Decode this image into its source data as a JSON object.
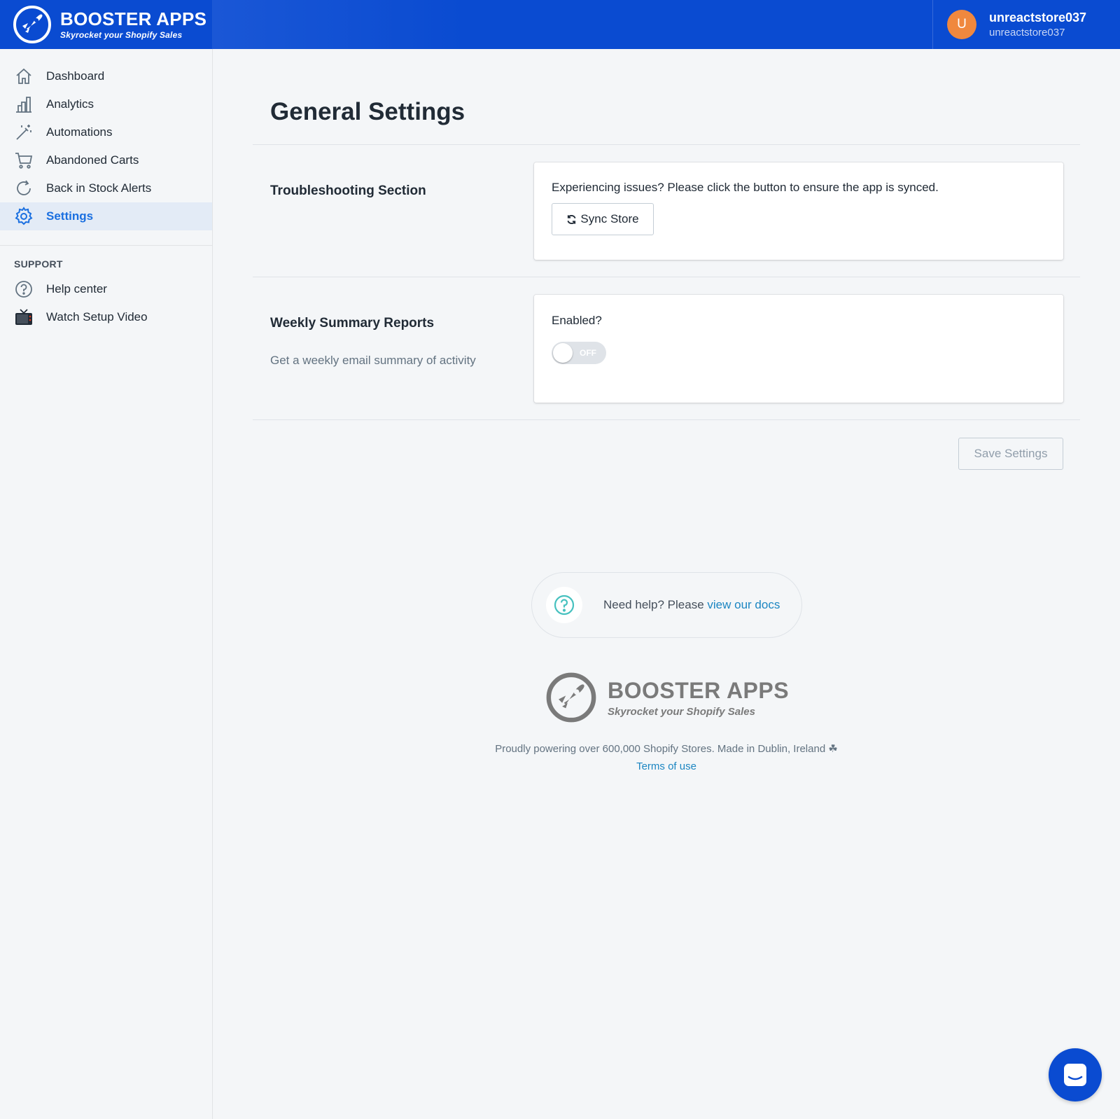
{
  "header": {
    "brand_name": "BOOSTER APPS",
    "brand_tagline": "Skyrocket your Shopify Sales",
    "avatar_initial": "U",
    "user_name": "unreactstore037",
    "user_sub": "unreactstore037"
  },
  "sidebar": {
    "items": [
      {
        "label": "Dashboard",
        "icon": "home-icon"
      },
      {
        "label": "Analytics",
        "icon": "bar-chart-icon"
      },
      {
        "label": "Automations",
        "icon": "magic-wand-icon"
      },
      {
        "label": "Abandoned Carts",
        "icon": "cart-icon"
      },
      {
        "label": "Back in Stock Alerts",
        "icon": "refresh-icon"
      },
      {
        "label": "Settings",
        "icon": "gear-icon",
        "active": true
      }
    ],
    "support_title": "SUPPORT",
    "support_items": [
      {
        "label": "Help center",
        "icon": "question-icon"
      },
      {
        "label": "Watch Setup Video",
        "icon": "tv-icon"
      }
    ]
  },
  "main": {
    "title": "General Settings",
    "troubleshooting": {
      "heading": "Troubleshooting Section",
      "text": "Experiencing issues? Please click the button to ensure the app is synced.",
      "button": "Sync Store"
    },
    "weekly": {
      "heading": "Weekly Summary Reports",
      "description": "Get a weekly email summary of activity",
      "enabled_label": "Enabled?",
      "toggle_text": "OFF",
      "toggle_on": false
    },
    "save_button": "Save Settings"
  },
  "help": {
    "text": "Need help? Please ",
    "link": "view our docs"
  },
  "footer": {
    "brand_name": "BOOSTER APPS",
    "brand_tagline": "Skyrocket your Shopify Sales",
    "powering": "Proudly powering over 600,000 Shopify Stores. Made in Dublin, Ireland ☘",
    "terms": "Terms of use"
  },
  "colors": {
    "header_bg": "#0a4bd1",
    "active_nav": "#1a6fe0",
    "avatar": "#f0883e",
    "link": "#1c86c2"
  }
}
